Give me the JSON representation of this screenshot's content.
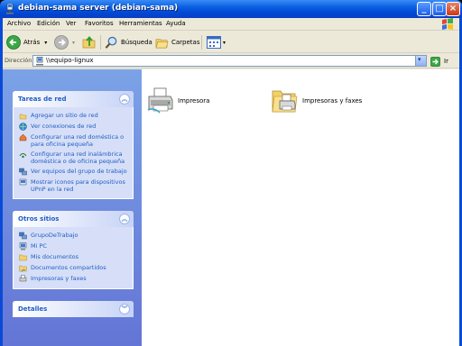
{
  "window": {
    "title": "debian-sama server (debian-sama)"
  },
  "menu": [
    "Archivo",
    "Edición",
    "Ver",
    "Favoritos",
    "Herramientas",
    "Ayuda"
  ],
  "toolbar": {
    "back_label": "Atrás",
    "search_label": "Búsqueda",
    "folders_label": "Carpetas"
  },
  "address": {
    "label": "Dirección",
    "value": "\\\\equipo-lignux",
    "go_label": "Ir"
  },
  "tasks_panel": {
    "title": "Tareas de red",
    "items": [
      "Agregar un sitio de red",
      "Ver conexiones de red",
      "Configurar una red doméstica o para oficina pequeña",
      "Configurar una red inalámbrica doméstica o de oficina pequeña",
      "Ver equipos del grupo de trabajo",
      "Mostrar iconos para dispositivos UPnP en la red"
    ]
  },
  "places_panel": {
    "title": "Otros sitios",
    "items": [
      "GrupoDeTrabajo",
      "Mi PC",
      "Mis documentos",
      "Documentos compartidos",
      "Impresoras y faxes"
    ]
  },
  "details_panel": {
    "title": "Detalles"
  },
  "content": {
    "items": [
      {
        "label": "Impresora",
        "icon": "printer-icon"
      },
      {
        "label": "Impresoras y faxes",
        "icon": "printers-folder-icon"
      }
    ]
  }
}
